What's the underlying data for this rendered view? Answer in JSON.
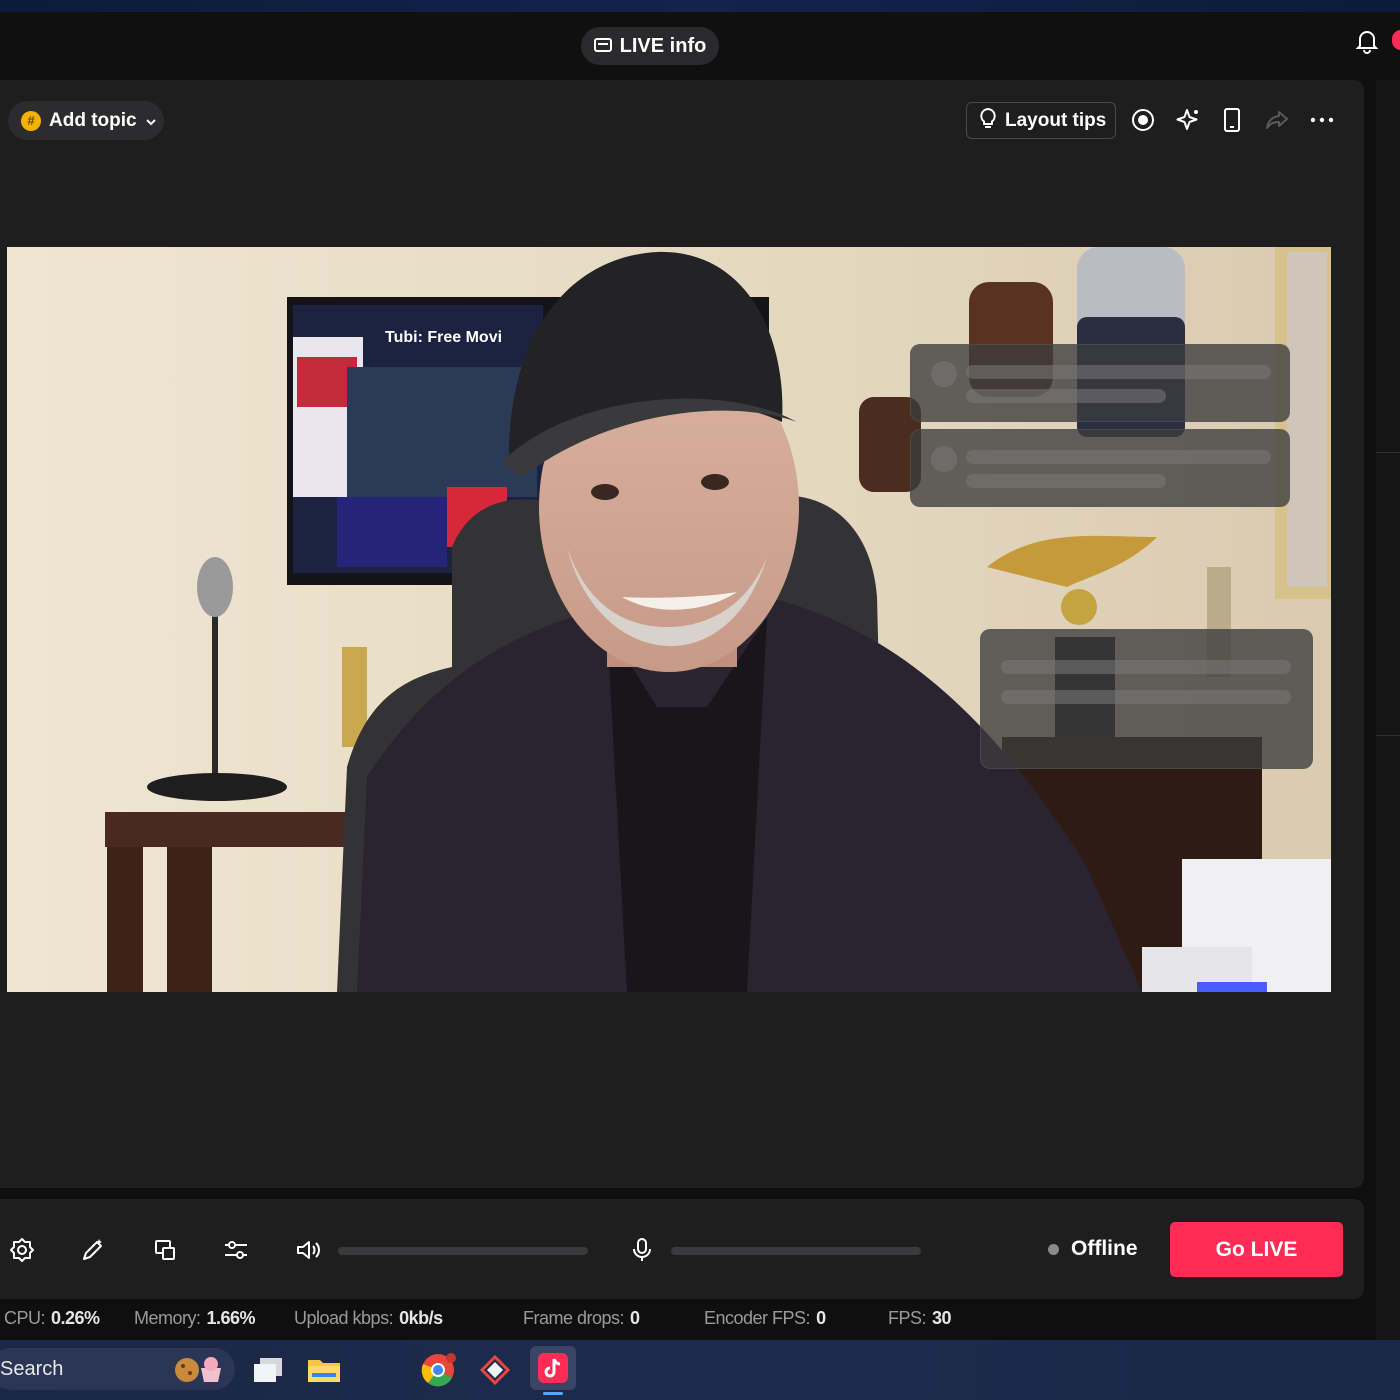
{
  "header": {
    "live_info_label": "LIVE info"
  },
  "toolbar": {
    "add_topic_label": "Add topic",
    "layout_tips_label": "Layout tips",
    "icons": [
      "record-icon",
      "sparkle-icon",
      "phone-icon",
      "share-icon",
      "more-icon"
    ]
  },
  "controls": {
    "status": "Offline",
    "go_live_label": "Go LIVE",
    "icons": [
      "settings-icon",
      "edit-icon",
      "screen-icon",
      "adjust-icon",
      "volume-icon",
      "mic-icon"
    ]
  },
  "stats": [
    {
      "label": "CPU:",
      "value": "0.26%"
    },
    {
      "label": "Memory:",
      "value": "1.66%"
    },
    {
      "label": "Upload kbps:",
      "value": "0kb/s"
    },
    {
      "label": "Frame drops:",
      "value": "0"
    },
    {
      "label": "Encoder FPS:",
      "value": "0"
    },
    {
      "label": "FPS:",
      "value": "30"
    }
  ],
  "video": {
    "tv_text": "Tubi: Free Movi"
  },
  "taskbar": {
    "search_label": "Search"
  },
  "colors": {
    "accent": "#fe2c55",
    "background": "#1e1e1f"
  }
}
